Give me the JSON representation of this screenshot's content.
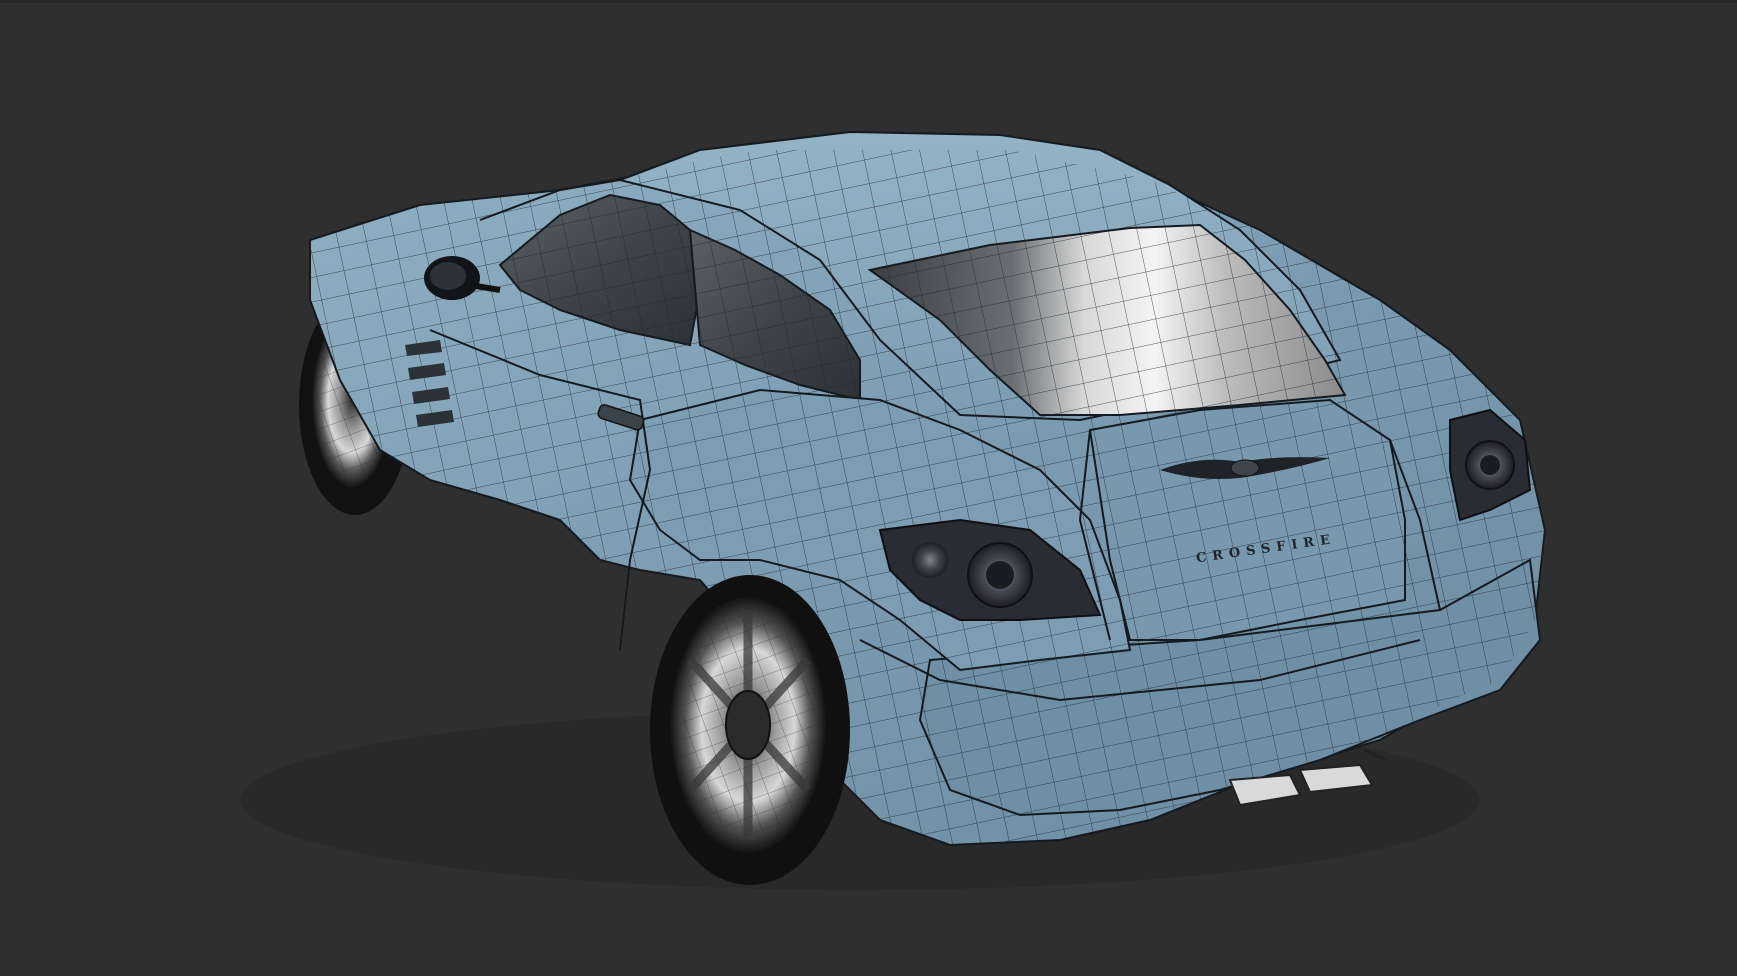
{
  "viewport": {
    "background": "#2f2f2f",
    "mode": "shaded-with-wireframe"
  },
  "model": {
    "badge_text": "CROSSFIRE",
    "body_color": "#7f9fb3",
    "edge_color": "#1a1f24",
    "glass_color": "#4b5459",
    "emblem": "winged-badge-icon"
  }
}
